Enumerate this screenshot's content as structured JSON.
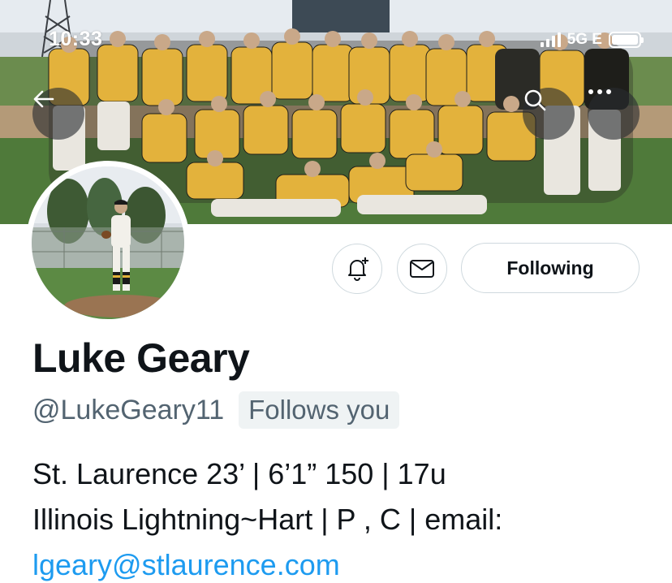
{
  "status_bar": {
    "time": "10:33",
    "network": "5G E",
    "signal_bars": 4,
    "battery_level": 1.0
  },
  "header": {
    "back_icon": "arrow-left-icon",
    "search_icon": "search-icon",
    "more_icon": "more-horizontal-icon"
  },
  "actions": {
    "notify_icon": "bell-plus-icon",
    "message_icon": "envelope-icon",
    "follow_label": "Following"
  },
  "profile": {
    "name": "Luke Geary",
    "handle": "@LukeGeary11",
    "follows_you": "Follows you",
    "bio_line1": "St. Laurence 23’ | 6’1” 150 | 17u",
    "bio_line2": "Illinois Lightning~Hart | P , C | email:",
    "bio_email": "lgeary@stlaurence.com"
  },
  "colors": {
    "text_primary": "#0f1419",
    "text_secondary": "#536471",
    "link": "#1d9bf0",
    "border": "#cfd9de",
    "badge_bg": "#eff3f4",
    "team_gold": "#e3b23c"
  }
}
